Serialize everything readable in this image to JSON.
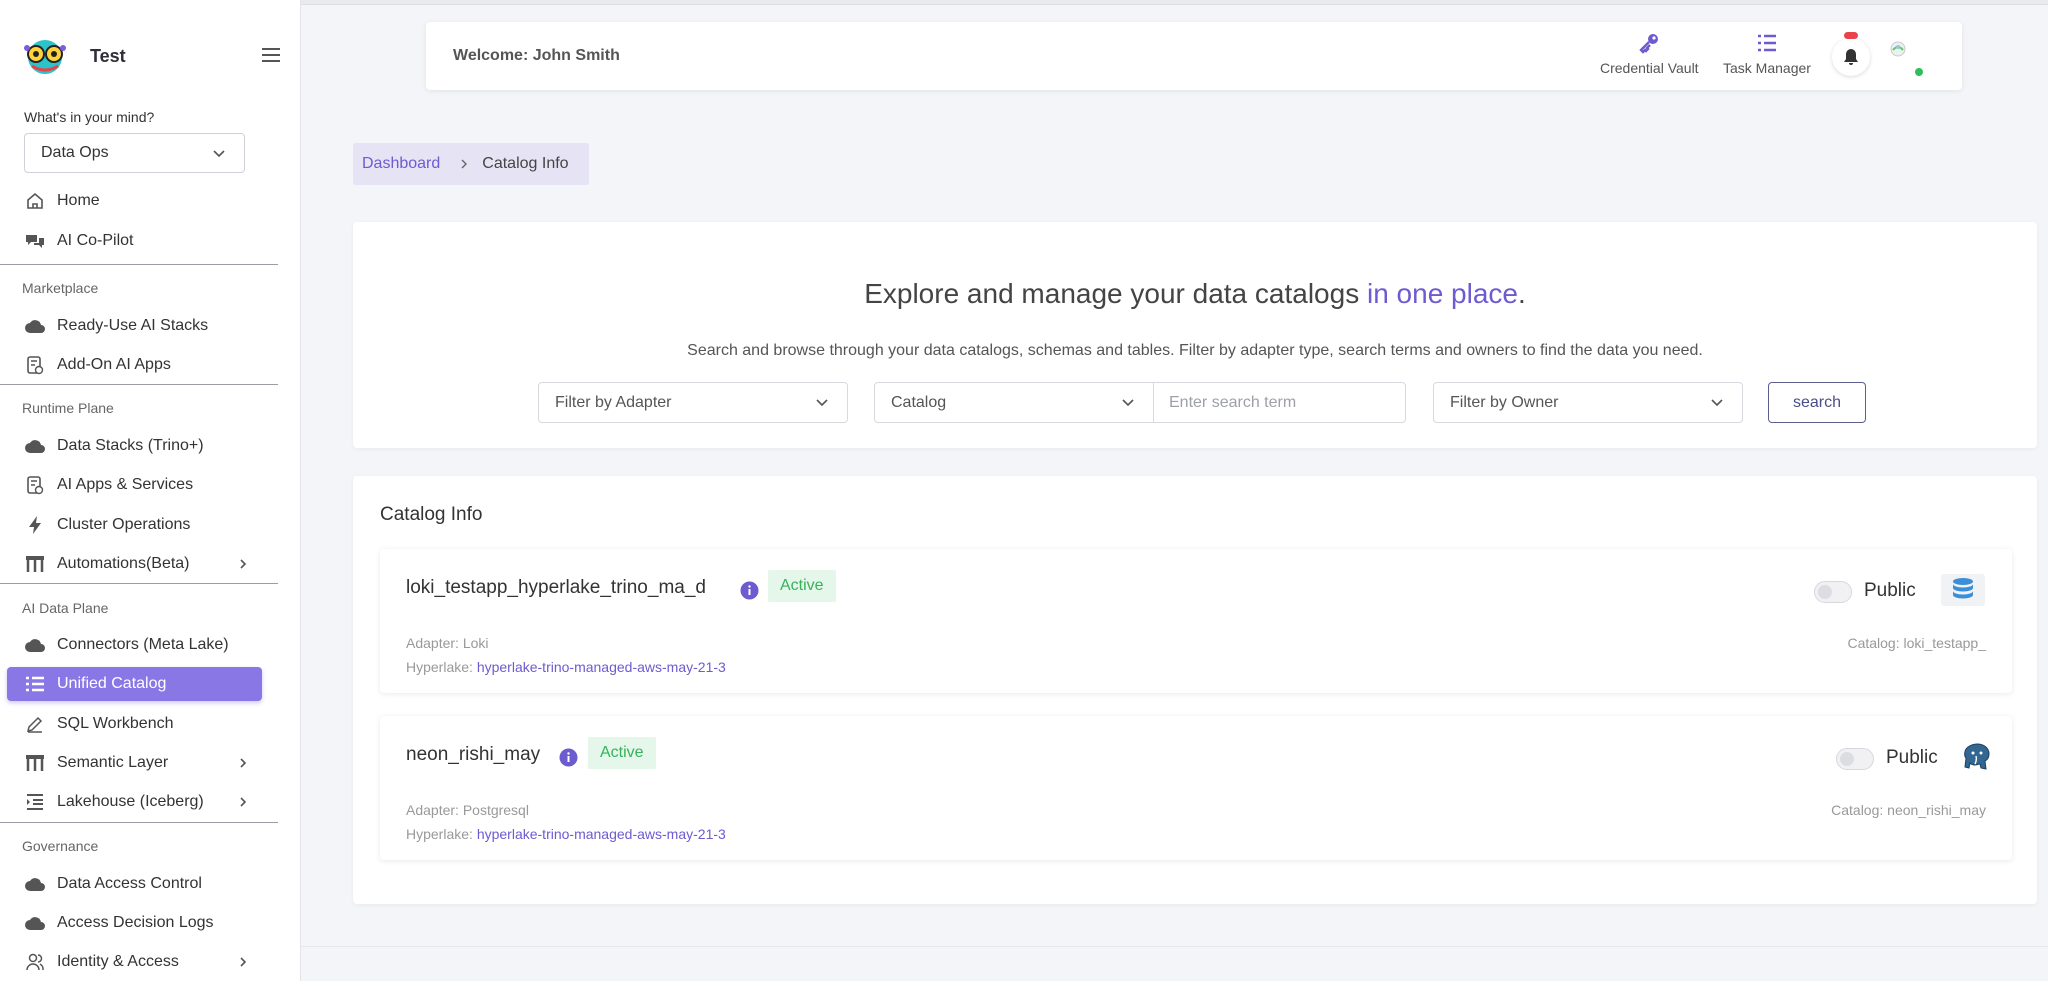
{
  "app": {
    "name": "Test"
  },
  "sidebar": {
    "mind_label": "What's in your mind?",
    "mind_value": "Data Ops",
    "items_top": [
      {
        "label": "Home",
        "icon": "home-icon"
      },
      {
        "label": "AI Co-Pilot",
        "icon": "chat-icon"
      }
    ],
    "sections": [
      {
        "title": "Marketplace",
        "items": [
          {
            "label": "Ready-Use AI Stacks",
            "icon": "cloud-icon"
          },
          {
            "label": "Add-On AI Apps",
            "icon": "app-icon"
          }
        ]
      },
      {
        "title": "Runtime Plane",
        "items": [
          {
            "label": "Data Stacks (Trino+)",
            "icon": "cloud-icon"
          },
          {
            "label": "AI Apps & Services",
            "icon": "app-icon"
          },
          {
            "label": "Cluster Operations",
            "icon": "bolt-icon"
          },
          {
            "label": "Automations(Beta)",
            "icon": "hierarchy-icon"
          }
        ]
      },
      {
        "title": "AI Data Plane",
        "items": [
          {
            "label": "Connectors (Meta Lake)",
            "icon": "cloud-icon"
          },
          {
            "label": "Unified Catalog",
            "icon": "list-icon"
          },
          {
            "label": "SQL Workbench",
            "icon": "edit-icon"
          },
          {
            "label": "Semantic Layer",
            "icon": "hierarchy-icon"
          },
          {
            "label": "Lakehouse (Iceberg)",
            "icon": "indent-icon"
          }
        ]
      },
      {
        "title": "Governance",
        "items": [
          {
            "label": "Data Access Control",
            "icon": "cloud-icon"
          },
          {
            "label": "Access Decision Logs",
            "icon": "cloud-icon"
          },
          {
            "label": "Identity & Access",
            "icon": "users-icon"
          }
        ]
      }
    ]
  },
  "header": {
    "welcome": "Welcome: John Smith",
    "credential_vault": "Credential Vault",
    "task_manager": "Task Manager"
  },
  "breadcrumb": {
    "root": "Dashboard",
    "current": "Catalog Info"
  },
  "explore": {
    "title_main": "Explore and manage your data catalogs ",
    "title_accent": "in one place",
    "title_end": ".",
    "subtitle": "Search and browse through your data catalogs, schemas and tables. Filter by adapter type, search terms and owners to find the data you need.",
    "filter_adapter": "Filter by Adapter",
    "filter_catalog": "Catalog",
    "search_placeholder": "Enter search term",
    "filter_owner": "Filter by Owner",
    "search_button": "search"
  },
  "catalog_panel": {
    "title": "Catalog Info",
    "items": [
      {
        "name": "loki_testapp_hyperlake_trino_ma_d",
        "status": "Active",
        "adapter": "Adapter: Loki",
        "hyperlake_label": "Hyperlake: ",
        "hyperlake_value": "hyperlake-trino-managed-aws-may-21-3",
        "visibility": "Public",
        "catalog_ref": "Catalog: loki_testapp_",
        "adapter_icon": "database-icon"
      },
      {
        "name": "neon_rishi_may",
        "status": "Active",
        "adapter": "Adapter: Postgresql",
        "hyperlake_label": "Hyperlake: ",
        "hyperlake_value": "hyperlake-trino-managed-aws-may-21-3",
        "visibility": "Public",
        "catalog_ref": "Catalog: neon_rishi_may",
        "adapter_icon": "postgresql-icon"
      }
    ]
  },
  "colors": {
    "accent": "#6d5bd0",
    "active_nav": "#8a77e6",
    "status_green": "#36b25b",
    "status_green_bg": "#e5f6ea",
    "notification_red": "#e8434b",
    "online_green": "#2fbf5a"
  }
}
